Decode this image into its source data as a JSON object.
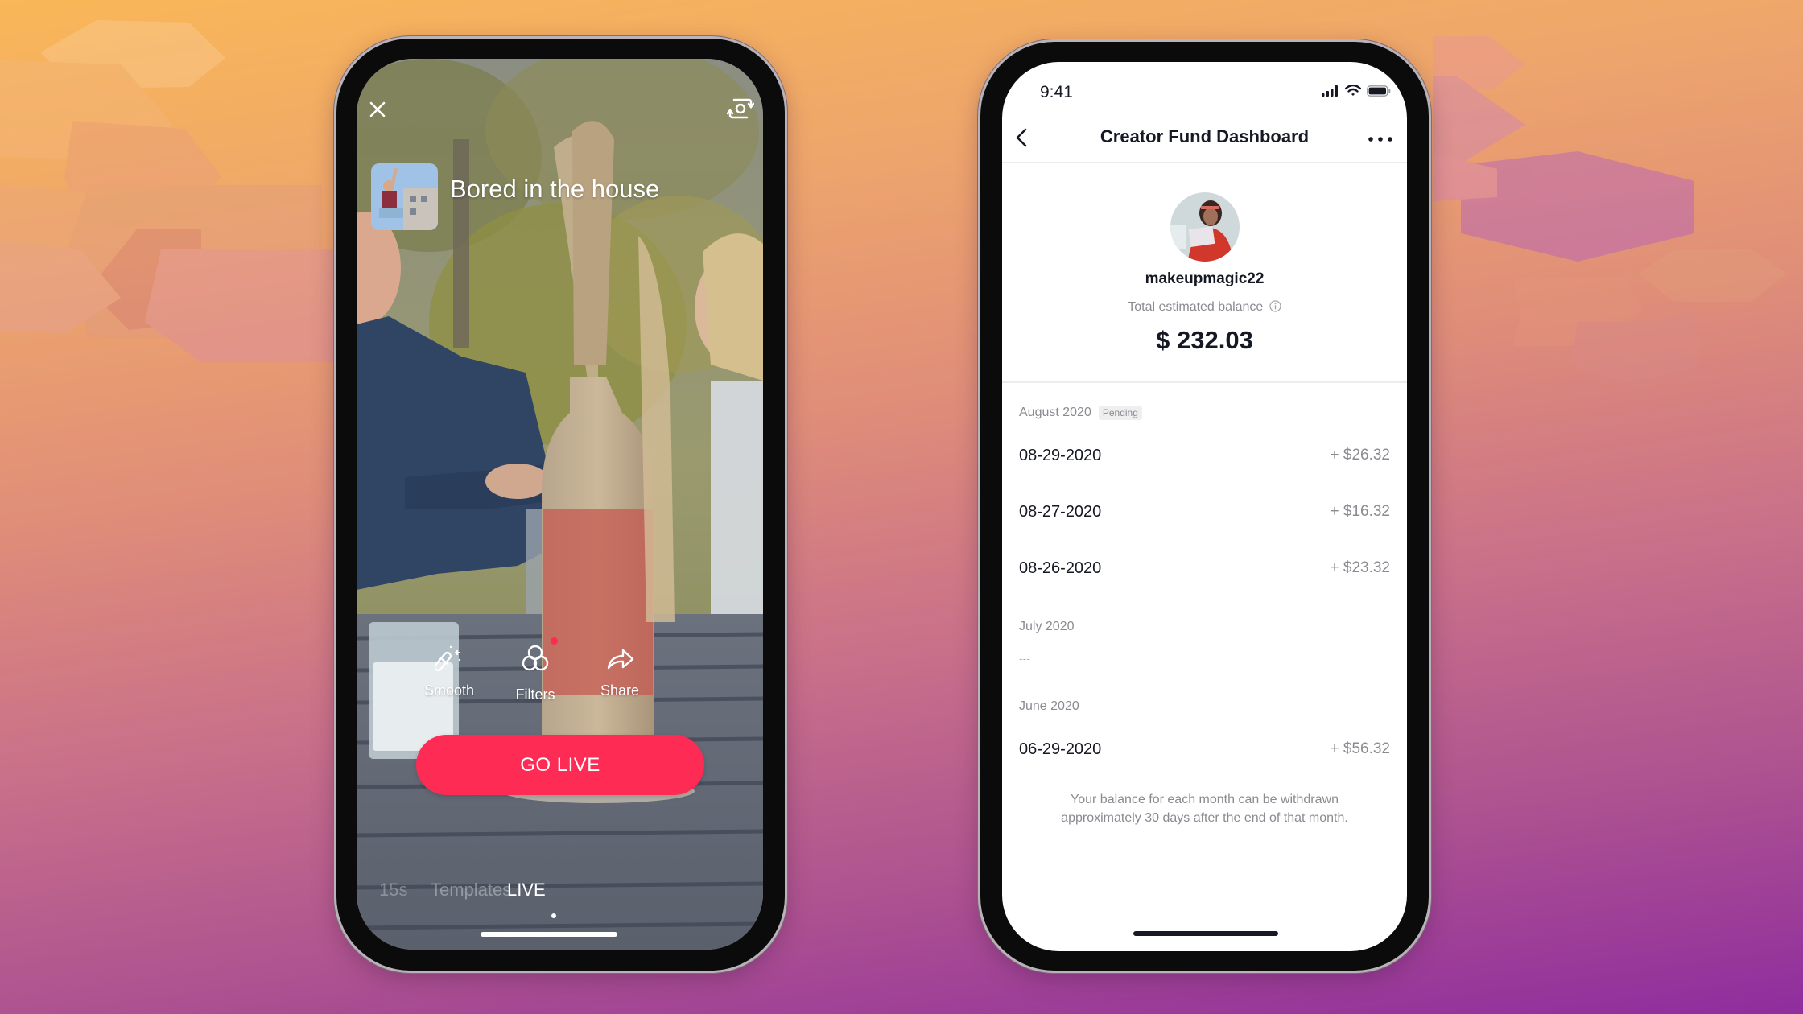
{
  "left_phone": {
    "screen": "TikTok LIVE camera",
    "close_icon": "close-icon",
    "flip_camera_icon": "flip-camera-icon",
    "live_title": "Bored in the house",
    "tools": [
      {
        "label": "Smooth",
        "icon": "magic-wand-icon"
      },
      {
        "label": "Filters",
        "icon": "filters-icon",
        "has_notification_dot": true
      },
      {
        "label": "Share",
        "icon": "share-icon"
      }
    ],
    "go_live_label": "GO LIVE",
    "mode_tabs": [
      {
        "label": "15s",
        "active": false
      },
      {
        "label": "Templates",
        "active": false
      },
      {
        "label": "LIVE",
        "active": true
      }
    ],
    "accent_color": "#fe2c55"
  },
  "right_phone": {
    "status_bar": {
      "time": "9:41",
      "icons": [
        "signal-icon",
        "wifi-icon",
        "battery-icon"
      ]
    },
    "nav": {
      "back_icon": "chevron-left-icon",
      "title": "Creator Fund Dashboard",
      "more_icon": "more-horizontal-icon"
    },
    "profile": {
      "username": "makeupmagic22",
      "balance_label": "Total estimated balance",
      "info_icon": "info-icon",
      "balance": "$ 232.03"
    },
    "months": [
      {
        "label": "August 2020",
        "badge": "Pending",
        "entries": [
          {
            "date": "08-29-2020",
            "amount": "+ $26.32"
          },
          {
            "date": "08-27-2020",
            "amount": "+ $16.32"
          },
          {
            "date": "08-26-2020",
            "amount": "+ $23.32"
          }
        ]
      },
      {
        "label": "July 2020",
        "empty_text": "---",
        "entries": []
      },
      {
        "label": "June 2020",
        "entries": [
          {
            "date": "06-29-2020",
            "amount": "+ $56.32"
          }
        ]
      }
    ],
    "footer_line1": "Your balance for each month can be withdrawn",
    "footer_line2": "approximately 30 days after the end of that month."
  }
}
